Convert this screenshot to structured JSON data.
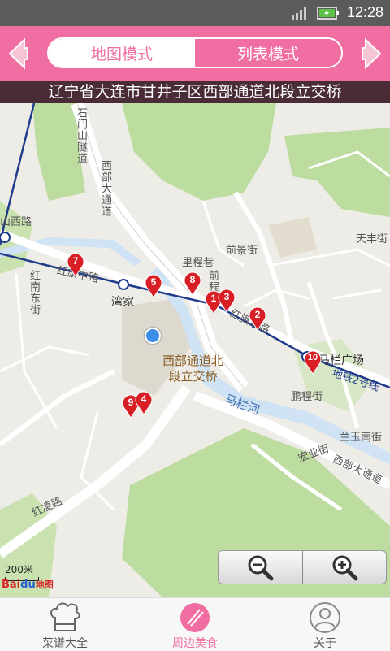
{
  "status_bar": {
    "time": "12:28"
  },
  "header": {
    "prev_icon": "left-arrow-icon",
    "next_icon": "right-arrow-icon",
    "segments": [
      {
        "label": "地图模式",
        "active": true
      },
      {
        "label": "列表模式",
        "active": false
      }
    ]
  },
  "address": "辽宁省大连市甘井子区西部通道北段立交桥",
  "map": {
    "street_labels": [
      "石门山隧道",
      "西部大通道",
      "山西路",
      "红旗中路",
      "红南东街",
      "湾家",
      "里程巷",
      "前景街",
      "前程巷",
      "红旗东路",
      "天丰街",
      "马栏广场",
      "地铁2号线",
      "鹏程街",
      "马栏河",
      "兰玉南街",
      "宏业街",
      "西部大通道",
      "红凌路"
    ],
    "place_name": [
      "西部通道北",
      "段立交桥"
    ],
    "pins": [
      "7",
      "5",
      "8",
      "1",
      "3",
      "2",
      "10",
      "9",
      "4"
    ],
    "scale": "200米",
    "logo": {
      "bai": "Bai",
      "du": "du",
      "map": "地图"
    },
    "zoom_out_icon": "zoom-out-icon",
    "zoom_in_icon": "zoom-in-icon"
  },
  "tabs": [
    {
      "label": "菜谱大全",
      "icon": "chef-hat-icon"
    },
    {
      "label": "周边美食",
      "icon": "nearby-food-icon",
      "active": true
    },
    {
      "label": "关于",
      "icon": "user-icon"
    }
  ]
}
